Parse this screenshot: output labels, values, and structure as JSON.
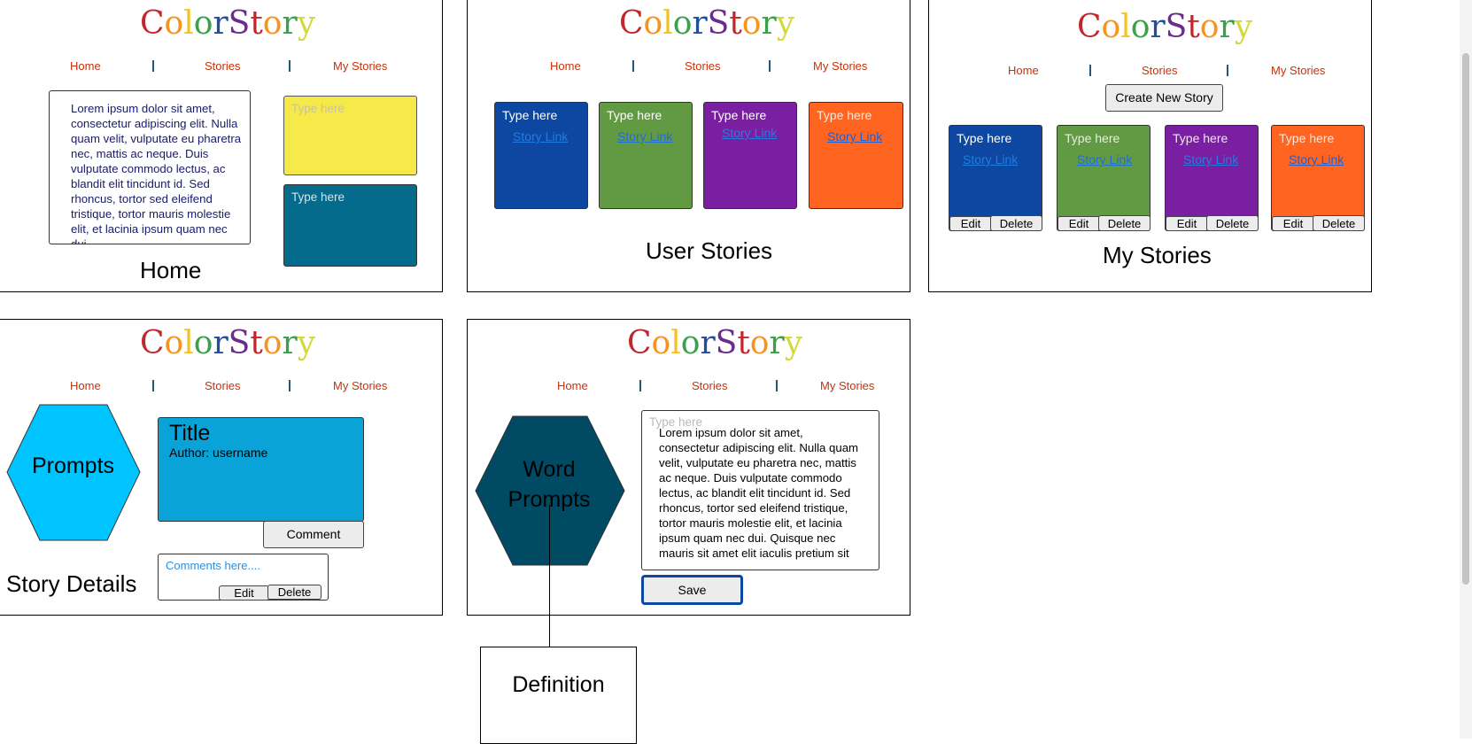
{
  "logo": {
    "letters": [
      "C",
      "o",
      "l",
      "o",
      "r",
      "S",
      "t",
      "o",
      "r",
      "y"
    ],
    "colors": [
      "#c1272d",
      "#f7941d",
      "#f6c324",
      "#3aa14a",
      "#1f4fa3",
      "#6a2c91",
      "#c1272d",
      "#f7941d",
      "#3aa14a",
      "#d4d93a"
    ]
  },
  "nav": {
    "home": "Home",
    "stories": "Stories",
    "my_stories": "My Stories"
  },
  "home_panel": {
    "caption": "Home",
    "lorem": "Lorem ipsum dolor sit amet, consectetur adipiscing elit. Nulla quam velit, vulputate eu pharetra nec, mattis ac neque. Duis vulputate commodo lectus, ac blandit elit tincidunt id. Sed rhoncus, tortor sed eleifend tristique, tortor mauris molestie elit, et lacinia ipsum quam nec dui.",
    "yellow_box": "Type here",
    "teal_box": "Type here"
  },
  "user_stories_panel": {
    "caption": "User Stories",
    "cards": [
      {
        "title": "Type here",
        "link": "Story Link",
        "color": "#0d47a1"
      },
      {
        "title": "Type here",
        "link": "Story Link",
        "color": "#629a44"
      },
      {
        "title": "Type here",
        "link": "Story Link",
        "color": "#7b1fa2"
      },
      {
        "title": "Type here",
        "link": "Story Link",
        "color": "#ff6520"
      }
    ]
  },
  "my_stories_panel": {
    "caption": "My Stories",
    "create_button": "Create New Story",
    "edit_label": "Edit",
    "delete_label": "Delete",
    "cards": [
      {
        "title": "Type here",
        "link": "Story Link",
        "color": "#0d47a1"
      },
      {
        "title": "Type here",
        "link": "Story Link",
        "color": "#629a44"
      },
      {
        "title": "Type here",
        "link": "Story Link",
        "color": "#7b1fa2"
      },
      {
        "title": "Type here",
        "link": "Story Link",
        "color": "#ff6520"
      }
    ]
  },
  "story_details_panel": {
    "caption": "Story Details",
    "prompts": "Prompts",
    "story_title": "Title",
    "author": "Author: username",
    "comment_button": "Comment",
    "comments_placeholder": "Comments here....",
    "edit_label": "Edit",
    "delete_label": "Delete"
  },
  "write_panel": {
    "word_prompts": "Word Prompts",
    "placeholder": "Type here",
    "lorem": "Lorem ipsum dolor sit amet, consectetur adipiscing elit. Nulla quam velit, vulputate eu pharetra nec, mattis ac neque. Duis vulputate commodo lectus, ac blandit elit tincidunt id. Sed rhoncus, tortor sed eleifend tristique, tortor mauris molestie elit, et lacinia ipsum quam nec dui. Quisque nec mauris sit amet elit iaculis pretium sit",
    "save_button": "Save",
    "definition": "Definition"
  }
}
